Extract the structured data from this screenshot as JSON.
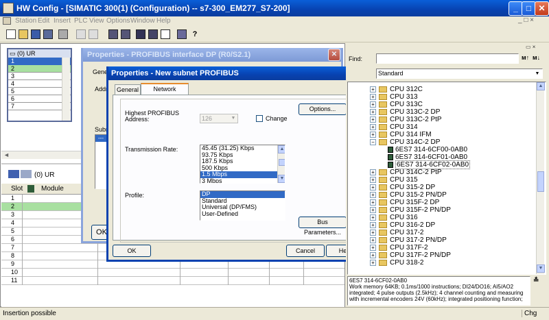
{
  "window": {
    "title": "HW Config - [SIMATIC 300(1) (Configuration) -- s7-300_EM277_S7-200]"
  },
  "menu": [
    "Station",
    "Edit",
    "Insert",
    "PLC",
    "View",
    "Options",
    "Window",
    "Help"
  ],
  "rack": {
    "title": "(0) UR",
    "rows": [
      "1",
      "2",
      "3",
      "4",
      "5",
      "6",
      "7"
    ]
  },
  "station_panel": {
    "title": "(0)  UR",
    "col_slot": "Slot",
    "col_module": "Module",
    "rows": [
      "1",
      "2",
      "3",
      "4",
      "5",
      "6",
      "7",
      "8",
      "9",
      "10",
      "11"
    ]
  },
  "status": {
    "left": "Insertion possible",
    "right": "Chg"
  },
  "dlg_back": {
    "title": "Properties - PROFIBUS interface  DP (R0/S2.1)",
    "general_frag": "Gener",
    "address_frag": "Addre",
    "subnet_frag": "Subne",
    "list_item": "---",
    "ok_frag": "OK"
  },
  "dlg_front": {
    "title": "Properties - New subnet PROFIBUS",
    "tabs": [
      "General",
      "Network Settings"
    ],
    "highest_label_1": "Highest PROFIBUS",
    "highest_label_2": "Address:",
    "highest_value": "126",
    "change_label": "Change",
    "options_button": "Options...",
    "transmission_label": "Transmission Rate:",
    "rates": [
      "45.45 (31.25) Kbps",
      "93.75 Kbps",
      "187.5 Kbps",
      "500 Kbps",
      "1.5 Mbps",
      "3 Mbps"
    ],
    "profile_label": "Profile:",
    "profiles": [
      "DP",
      "Standard",
      "Universal (DP/FMS)",
      "User-Defined"
    ],
    "bus_params_button": "Bus Parameters...",
    "ok": "OK",
    "cancel": "Cancel",
    "help": "Help"
  },
  "catalog": {
    "find_label": "Find:",
    "find_value": "",
    "profile_value": "Standard",
    "tree": [
      {
        "label": "CPU 312C",
        "type": "folder"
      },
      {
        "label": "CPU 313",
        "type": "folder"
      },
      {
        "label": "CPU 313C",
        "type": "folder"
      },
      {
        "label": "CPU 313C-2 DP",
        "type": "folder"
      },
      {
        "label": "CPU 313C-2 PtP",
        "type": "folder"
      },
      {
        "label": "CPU 314",
        "type": "folder"
      },
      {
        "label": "CPU 314 IFM",
        "type": "folder"
      },
      {
        "label": "CPU 314C-2 DP",
        "type": "folder-open"
      },
      {
        "label": "6ES7 314-6CF00-0AB0",
        "type": "module"
      },
      {
        "label": "6ES7 314-6CF01-0AB0",
        "type": "module"
      },
      {
        "label": "6ES7 314-6CF02-0AB0",
        "type": "module-selected"
      },
      {
        "label": "CPU 314C-2 PtP",
        "type": "folder"
      },
      {
        "label": "CPU 315",
        "type": "folder"
      },
      {
        "label": "CPU 315-2 DP",
        "type": "folder"
      },
      {
        "label": "CPU 315-2 PN/DP",
        "type": "folder"
      },
      {
        "label": "CPU 315F-2 DP",
        "type": "folder"
      },
      {
        "label": "CPU 315F-2 PN/DP",
        "type": "folder"
      },
      {
        "label": "CPU 316",
        "type": "folder"
      },
      {
        "label": "CPU 316-2 DP",
        "type": "folder"
      },
      {
        "label": "CPU 317-2",
        "type": "folder"
      },
      {
        "label": "CPU 317-2 PN/DP",
        "type": "folder"
      },
      {
        "label": "CPU 317F-2",
        "type": "folder"
      },
      {
        "label": "CPU 317F-2 PN/DP",
        "type": "folder"
      },
      {
        "label": "CPU 318-2",
        "type": "folder"
      }
    ],
    "info_title": "6ES7 314-6CF02-0AB0",
    "info_text": "Work memory 64KB; 0.1ms/1000 instructions; DI24/DO16; AI5/AO2 integrated; 4 pulse outputs (2.5kHz); 4 channel counting and measuring with incremental encoders 24V (60kHz); integrated positioning function;"
  },
  "colors": {
    "title_blue": "#0a5fd8",
    "selection": "#316ac5",
    "green_row": "#a8e0a0"
  }
}
